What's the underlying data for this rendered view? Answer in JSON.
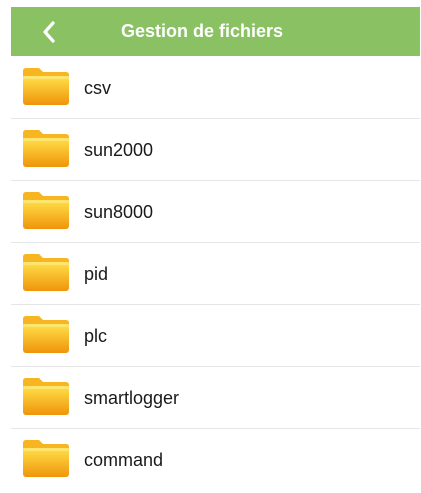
{
  "header": {
    "title": "Gestion de fichiers",
    "back_icon": "chevron-left-icon",
    "background_color": "#8ac163"
  },
  "files": [
    {
      "name": "csv",
      "icon": "folder-icon"
    },
    {
      "name": "sun2000",
      "icon": "folder-icon"
    },
    {
      "name": "sun8000",
      "icon": "folder-icon"
    },
    {
      "name": "pid",
      "icon": "folder-icon"
    },
    {
      "name": "plc",
      "icon": "folder-icon"
    },
    {
      "name": "smartlogger",
      "icon": "folder-icon"
    },
    {
      "name": "command",
      "icon": "folder-icon"
    }
  ],
  "colors": {
    "folder_top": "#ffd42a",
    "folder_bottom": "#f29a0c",
    "divider": "#e6e6e6"
  }
}
